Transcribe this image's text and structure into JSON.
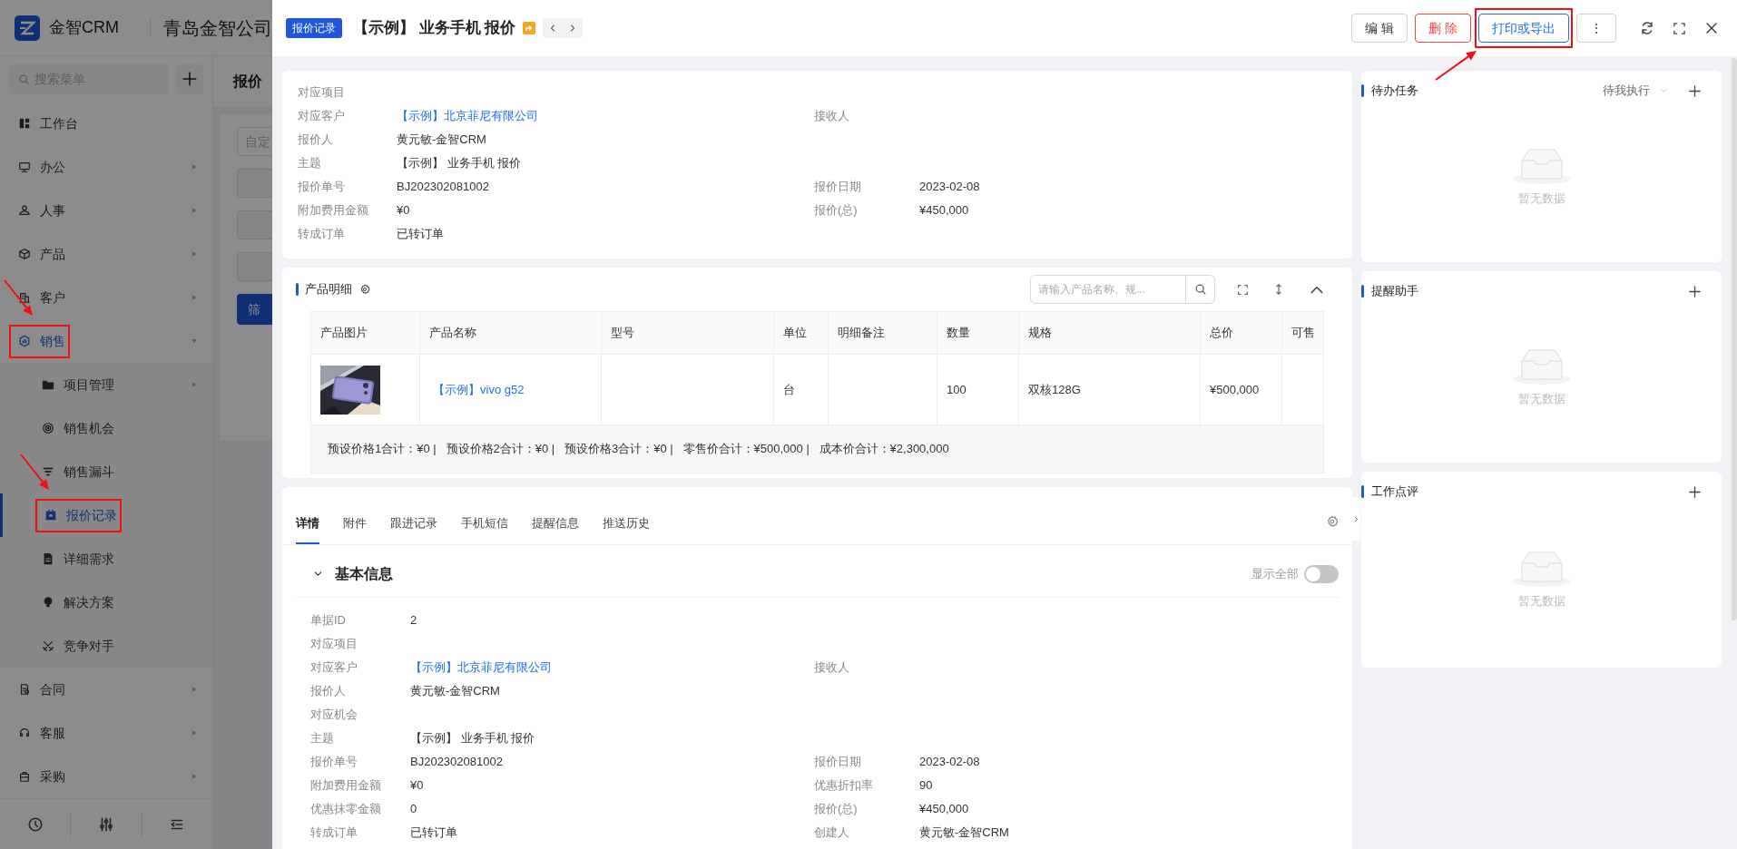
{
  "sidebar": {
    "logo": "金智CRM",
    "company": "青岛金智公司",
    "search": {
      "placeholder": "搜索菜单"
    },
    "items": [
      {
        "label": "工作台",
        "selected": false,
        "annotated": false
      },
      {
        "label": "办公",
        "selected": false,
        "expanded": false,
        "annotated": false
      },
      {
        "label": "人事",
        "selected": false,
        "expanded": false,
        "annotated": false
      },
      {
        "label": "产品",
        "selected": false,
        "expanded": false,
        "annotated": false
      },
      {
        "label": "客户",
        "selected": false,
        "expanded": false,
        "annotated": false
      },
      {
        "label": "销售",
        "selected": false,
        "expanded": true,
        "annotated": true,
        "children": [
          {
            "label": "项目管理",
            "selected": false,
            "expanded": false,
            "annotated": false
          },
          {
            "label": "销售机会",
            "selected": false,
            "annotated": false
          },
          {
            "label": "销售漏斗",
            "selected": false,
            "annotated": false
          },
          {
            "label": "报价记录",
            "selected": true,
            "annotated": true
          },
          {
            "label": "详细需求",
            "selected": false,
            "annotated": false
          },
          {
            "label": "解决方案",
            "selected": false,
            "annotated": false
          },
          {
            "label": "竞争对手",
            "selected": false,
            "annotated": false
          }
        ]
      },
      {
        "label": "合同",
        "selected": false,
        "expanded": false,
        "annotated": false
      },
      {
        "label": "客服",
        "selected": false,
        "expanded": false,
        "annotated": false
      },
      {
        "label": "采购",
        "selected": false,
        "expanded": false,
        "annotated": false
      }
    ]
  },
  "background": {
    "title": "报价",
    "filter_field": "自定",
    "filter_button": "筛"
  },
  "drawer": {
    "tag": "报价记录",
    "title": "【示例】 业务手机 报价",
    "actions": [
      {
        "label": "编 辑",
        "kind": "default",
        "annotated": false
      },
      {
        "label": "删 除",
        "kind": "danger",
        "annotated": false
      },
      {
        "label": "打印或导出",
        "kind": "primary",
        "annotated": true
      },
      {
        "label": "⋮",
        "kind": "more",
        "annotated": false
      }
    ]
  },
  "summary": {
    "rows": [
      {
        "label": "对应项目"
      },
      {
        "label": "对应客户",
        "value": "【示例】北京菲尼有限公司",
        "link": true,
        "right": {
          "label": "接收人"
        }
      },
      {
        "label": "报价人",
        "value": "黄元敏-金智CRM",
        "link": false
      },
      {
        "label": "主题",
        "value": "【示例】 业务手机 报价",
        "link": false
      },
      {
        "label": "报价单号",
        "value": "BJ202302081002",
        "link": false,
        "right": {
          "label": "报价日期",
          "value": "2023-02-08"
        }
      },
      {
        "label": "附加费用金额",
        "value": "¥0",
        "link": false,
        "right": {
          "label": "报价(总)",
          "value": "¥450,000"
        }
      },
      {
        "label": "转成订单",
        "value": "已转订单",
        "link": false
      }
    ]
  },
  "products": {
    "title": "产品明细",
    "search": {
      "placeholder": "请输入产品名称、规..."
    },
    "columns": [
      "产品图片",
      "产品名称",
      "型号",
      "单位",
      "明细备注",
      "数量",
      "规格",
      "总价",
      "可售"
    ],
    "rows": [
      {
        "name": "【示例】vivo g52",
        "model": "",
        "unit": "台",
        "note": "",
        "quantity": "100",
        "spec": "双核128G",
        "total": "¥500,000"
      }
    ],
    "footer": "预设价格1合计：¥0 |   预设价格2合计：¥0 |   预设价格3合计：¥0 |   零售价合计：¥500,000 |   成本价合计：¥2,300,000"
  },
  "details": {
    "tabs": [
      {
        "label": "详情",
        "selected": true
      },
      {
        "label": "附件",
        "selected": false
      },
      {
        "label": "跟进记录",
        "selected": false
      },
      {
        "label": "手机短信",
        "selected": false
      },
      {
        "label": "提醒信息",
        "selected": false
      },
      {
        "label": "推送历史",
        "selected": false
      }
    ],
    "section": {
      "title": "基本信息",
      "expanded": true,
      "show_all": {
        "label": "显示全部",
        "on": false
      }
    },
    "rows": [
      {
        "label": "单据ID",
        "value": "2",
        "link": false
      },
      {
        "label": "对应项目"
      },
      {
        "label": "对应客户",
        "value": "【示例】北京菲尼有限公司",
        "link": true,
        "right": {
          "label": "接收人"
        }
      },
      {
        "label": "报价人",
        "value": "黄元敏-金智CRM",
        "link": false
      },
      {
        "label": "对应机会"
      },
      {
        "label": "主题",
        "value": "【示例】 业务手机 报价",
        "link": false
      },
      {
        "label": "报价单号",
        "value": "BJ202302081002",
        "link": false,
        "right": {
          "label": "报价日期",
          "value": "2023-02-08"
        }
      },
      {
        "label": "附加费用金额",
        "value": "¥0",
        "link": false,
        "right": {
          "label": "优惠折扣率",
          "value": "90"
        }
      },
      {
        "label": "优惠抹零金额",
        "value": "0",
        "link": false,
        "right": {
          "label": "报价(总)",
          "value": "¥450,000"
        }
      },
      {
        "label": "转成订单",
        "value": "已转订单",
        "link": false,
        "right": {
          "label": "创建人",
          "value": "黄元敏-金智CRM"
        }
      }
    ]
  },
  "panels": [
    {
      "title": "待办任务",
      "filter": "待我执行",
      "empty": "暂无数据"
    },
    {
      "title": "提醒助手",
      "empty": "暂无数据"
    },
    {
      "title": "工作点评",
      "empty": "暂无数据"
    }
  ]
}
